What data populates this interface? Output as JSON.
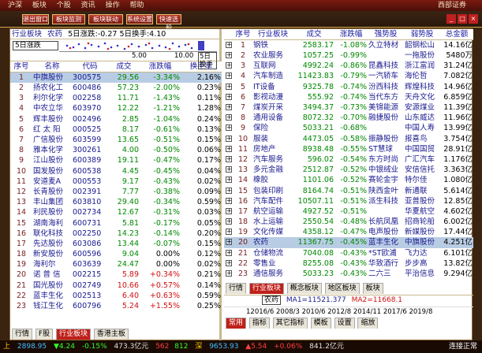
{
  "titlebar": {
    "items": [
      "沪深",
      "板块",
      "个股",
      "资讯",
      "操作",
      "帮助"
    ],
    "right": "西部证券"
  },
  "toolbar": {
    "buttons": [
      "退出窗口",
      "板块监测",
      "板块联动",
      "系统设置",
      "快速选股"
    ]
  },
  "left": {
    "header": {
      "board": "行业板块",
      "name": "农药",
      "info": "5日涨跌:-0.27 5日换手:4.10"
    },
    "mini_chart": {
      "label": "5日涨跌",
      "tick1": "5.00",
      "tick2": "10.00",
      "tick3": "5日换手"
    },
    "columns": [
      "序号",
      "名称",
      "代码",
      "成交",
      "涨跌幅",
      "换手率"
    ],
    "rows": [
      {
        "idx": "1",
        "name": "中旗股份",
        "code": "300575",
        "price": "29.56",
        "chg": "-3.34%",
        "turn": "2.16%",
        "sel": true
      },
      {
        "idx": "2",
        "name": "扬农化工",
        "code": "600486",
        "price": "57.23",
        "chg": "-2.00%",
        "turn": "0.23%"
      },
      {
        "idx": "3",
        "name": "利尔化学",
        "code": "002258",
        "price": "11.71",
        "chg": "-1.43%",
        "turn": "0.11%"
      },
      {
        "idx": "4",
        "name": "中农立华",
        "code": "603970",
        "price": "12.22",
        "chg": "-1.21%",
        "turn": "1.28%"
      },
      {
        "idx": "5",
        "name": "辉丰股份",
        "code": "002496",
        "price": "2.85",
        "chg": "-1.04%",
        "turn": "0.24%"
      },
      {
        "idx": "6",
        "name": "红 太 阳",
        "code": "000525",
        "price": "8.17",
        "chg": "-0.61%",
        "turn": "0.13%"
      },
      {
        "idx": "7",
        "name": "广信股份",
        "code": "603599",
        "price": "13.65",
        "chg": "-0.51%",
        "turn": "0.15%"
      },
      {
        "idx": "8",
        "name": "雅本化学",
        "code": "300261",
        "price": "4.00",
        "chg": "-0.50%",
        "turn": "0.06%"
      },
      {
        "idx": "9",
        "name": "江山股份",
        "code": "600389",
        "price": "19.11",
        "chg": "-0.47%",
        "turn": "0.17%"
      },
      {
        "idx": "10",
        "name": "国发股份",
        "code": "600538",
        "price": "4.45",
        "chg": "-0.45%",
        "turn": "0.04%"
      },
      {
        "idx": "11",
        "name": "安道麦A",
        "code": "000553",
        "price": "9.17",
        "chg": "-0.43%",
        "turn": "0.02%"
      },
      {
        "idx": "12",
        "name": "长青股份",
        "code": "002391",
        "price": "7.77",
        "chg": "-0.38%",
        "turn": "0.09%"
      },
      {
        "idx": "13",
        "name": "丰山集团",
        "code": "603810",
        "price": "29.40",
        "chg": "-0.34%",
        "turn": "0.59%"
      },
      {
        "idx": "14",
        "name": "利民股份",
        "code": "002734",
        "price": "12.67",
        "chg": "-0.31%",
        "turn": "0.03%"
      },
      {
        "idx": "15",
        "name": "湖南海利",
        "code": "600731",
        "price": "5.81",
        "chg": "-0.17%",
        "turn": "0.05%"
      },
      {
        "idx": "16",
        "name": "联化科技",
        "code": "002250",
        "price": "14.23",
        "chg": "-0.14%",
        "turn": "0.20%"
      },
      {
        "idx": "17",
        "name": "先达股份",
        "code": "603086",
        "price": "13.44",
        "chg": "-0.07%",
        "turn": "0.15%"
      },
      {
        "idx": "18",
        "name": "新安股份",
        "code": "600596",
        "price": "9.04",
        "chg": "0.00%",
        "turn": "0.12%",
        "c": "n"
      },
      {
        "idx": "19",
        "name": "海利尔",
        "code": "603639",
        "price": "24.47",
        "chg": "0.00%",
        "turn": "0.02%",
        "c": "n"
      },
      {
        "idx": "20",
        "name": "诺 普 信",
        "code": "002215",
        "price": "5.89",
        "chg": "+0.34%",
        "turn": "0.21%",
        "c": "r"
      },
      {
        "idx": "21",
        "name": "国光股份",
        "code": "002749",
        "price": "10.66",
        "chg": "+0.57%",
        "turn": "0.14%",
        "c": "r"
      },
      {
        "idx": "22",
        "name": "蓝丰生化",
        "code": "002513",
        "price": "6.40",
        "chg": "+0.63%",
        "turn": "0.59%",
        "c": "r"
      },
      {
        "idx": "23",
        "name": "钱江生化",
        "code": "600796",
        "price": "5.24",
        "chg": "+1.55%",
        "turn": "0.25%",
        "c": "r"
      }
    ],
    "tabs": [
      "行情",
      "F股",
      "行业板块",
      "香港主板"
    ]
  },
  "right": {
    "columns": [
      "序号",
      "行业板块",
      "成交",
      "涨跌幅",
      "强势股",
      "弱势股",
      "总金额"
    ],
    "rows": [
      {
        "idx": "1",
        "name": "钢铁",
        "price": "2583.17",
        "chg": "-1.08%",
        "strong": "久立特材",
        "weak": "韶钢松山",
        "amt": "14.16亿"
      },
      {
        "idx": "2",
        "name": "农业服务",
        "price": "1057.25",
        "chg": "-0.99%",
        "strong": "",
        "weak": "一拖股份",
        "amt": "5480万"
      },
      {
        "idx": "3",
        "name": "互联网",
        "price": "4992.24",
        "chg": "-0.86%",
        "strong": "昆鑫科技",
        "weak": "浙江富润",
        "amt": "31.24亿"
      },
      {
        "idx": "4",
        "name": "汽车制造",
        "price": "11423.83",
        "chg": "-0.79%",
        "strong": "一汽轿车",
        "weak": "海伦哲",
        "amt": "7.082亿"
      },
      {
        "idx": "5",
        "name": "IT设备",
        "price": "9325.78",
        "chg": "-0.74%",
        "strong": "汾西科技",
        "weak": "辉煌科技",
        "amt": "14.96亿"
      },
      {
        "idx": "6",
        "name": "影视动漫",
        "price": "555.92",
        "chg": "-0.74%",
        "strong": "当代东方",
        "weak": "天舟文化",
        "amt": "6.859亿"
      },
      {
        "idx": "7",
        "name": "煤炭开采",
        "price": "3494.37",
        "chg": "-0.73%",
        "strong": "美锦能源",
        "weak": "安源煤业",
        "amt": "11.39亿"
      },
      {
        "idx": "8",
        "name": "通用设备",
        "price": "8072.32",
        "chg": "-0.70%",
        "strong": "融捷股份",
        "weak": "山东威达",
        "amt": "11.96亿"
      },
      {
        "idx": "9",
        "name": "保险",
        "price": "5033.21",
        "chg": "-0.68%",
        "strong": "",
        "weak": "中国人寿",
        "amt": "13.99亿"
      },
      {
        "idx": "10",
        "name": "服装",
        "price": "4473.05",
        "chg": "-0.58%",
        "strong": "振静股份",
        "weak": "报喜鸟",
        "amt": "3.754亿"
      },
      {
        "idx": "11",
        "name": "房地产",
        "price": "8938.48",
        "chg": "-0.55%",
        "strong": "ST慧球",
        "weak": "中国国贸",
        "amt": "28.91亿"
      },
      {
        "idx": "12",
        "name": "汽车服务",
        "price": "596.02",
        "chg": "-0.54%",
        "strong": "东方时尚",
        "weak": "广汇汽车",
        "amt": "1.176亿"
      },
      {
        "idx": "13",
        "name": "多元金融",
        "price": "2512.87",
        "chg": "-0.52%",
        "strong": "中银绒业",
        "weak": "安信信托",
        "amt": "3.363亿"
      },
      {
        "idx": "14",
        "name": "橡胶",
        "price": "1101.06",
        "chg": "-0.52%",
        "strong": "赛轮金宇",
        "weak": "特尔佳",
        "amt": "1.080亿"
      },
      {
        "idx": "15",
        "name": "包装印刷",
        "price": "8164.74",
        "chg": "-0.51%",
        "strong": "陕西金叶",
        "weak": "新通联",
        "amt": "5.614亿"
      },
      {
        "idx": "16",
        "name": "汽车配件",
        "price": "10507.11",
        "chg": "-0.51%",
        "strong": "派生科技",
        "weak": "亚普股份",
        "amt": "12.85亿"
      },
      {
        "idx": "17",
        "name": "航空运输",
        "price": "4927.52",
        "chg": "-0.51%",
        "strong": "",
        "weak": "华夏航空",
        "amt": "4.602亿"
      },
      {
        "idx": "18",
        "name": "水上运输",
        "price": "2550.54",
        "chg": "-0.48%",
        "strong": "长航凤凰",
        "weak": "招商轮船",
        "amt": "6.002亿"
      },
      {
        "idx": "19",
        "name": "文化传媒",
        "price": "4358.12",
        "chg": "-0.47%",
        "strong": "电声股份",
        "weak": "新媒股份",
        "amt": "17.44亿"
      },
      {
        "idx": "20",
        "name": "农药",
        "price": "11367.75",
        "chg": "-0.45%",
        "strong": "蓝丰生化",
        "weak": "中旗股份",
        "amt": "4.251亿",
        "sel": true
      },
      {
        "idx": "21",
        "name": "仓储物流",
        "price": "7040.08",
        "chg": "-0.43%",
        "strong": "*ST欧浦",
        "weak": "飞力达",
        "amt": "6.101亿"
      },
      {
        "idx": "22",
        "name": "零售业",
        "price": "8255.08",
        "chg": "-0.43%",
        "strong": "华致酒行",
        "weak": "步步高",
        "amt": "13.82亿"
      },
      {
        "idx": "23",
        "name": "通信服务",
        "price": "5033.23",
        "chg": "-0.43%",
        "strong": "二六三",
        "weak": "平治信息",
        "amt": "9.294亿"
      }
    ],
    "tabs": [
      "行情",
      "行业板块",
      "概念板块",
      "地区板块",
      "板块"
    ],
    "footer1": {
      "label": "农药",
      "ma1": "MA1=11521.377",
      "ma2": "MA2=11668.1"
    },
    "footer2": "12016/6 2008/3 2010/6 2012/8 2014/11 2017/6 2019/8",
    "footer_tabs": [
      "常用",
      "指标",
      "其它指标",
      "模板",
      "设置",
      "缩放"
    ]
  },
  "status": {
    "items": [
      "上",
      "2898.95",
      "▼4.24",
      "-0.15%",
      "473.3亿元",
      "562",
      "812",
      "深",
      "9653.93",
      "▲5.54",
      "+0.06%",
      "841.2亿元"
    ],
    "right": "连接正常"
  }
}
